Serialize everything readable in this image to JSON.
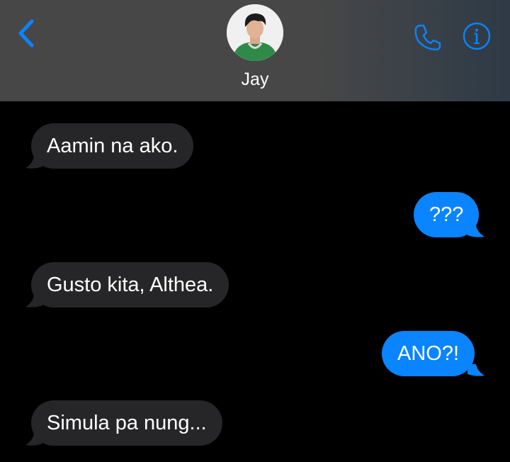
{
  "header": {
    "contact_name": "Jay",
    "back_icon": "chevron-left-icon",
    "call_icon": "phone-icon",
    "info_icon": "info-icon"
  },
  "colors": {
    "header_bg": "#474747",
    "accent": "#0a84ff",
    "incoming_bubble": "#262628",
    "outgoing_bubble": "#0a84ff",
    "background": "#000000"
  },
  "messages": [
    {
      "direction": "incoming",
      "text": "Aamin na ako."
    },
    {
      "direction": "outgoing",
      "text": "???"
    },
    {
      "direction": "incoming",
      "text": "Gusto kita, Althea."
    },
    {
      "direction": "outgoing",
      "text": "ANO?!"
    },
    {
      "direction": "incoming",
      "text": "Simula pa nung..."
    }
  ]
}
